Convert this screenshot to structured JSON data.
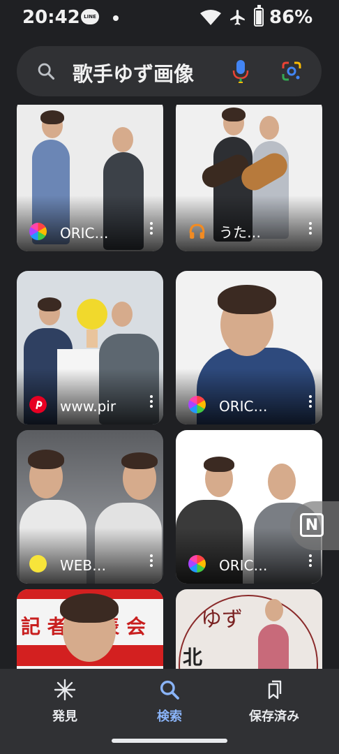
{
  "status_bar": {
    "time": "20:42",
    "line_badge": "LINE",
    "battery_percent": "86%",
    "battery_level": 0.86
  },
  "search": {
    "query": "歌手ゆず画像"
  },
  "results": [
    {
      "source_label": "ORIC…",
      "source_icon": "oricon-icon"
    },
    {
      "source_label": "うた…",
      "source_icon": "headphones-icon"
    },
    {
      "source_label": "www.pir",
      "source_icon": "pinterest-icon"
    },
    {
      "source_label": "ORIC…",
      "source_icon": "oricon-icon"
    },
    {
      "source_label": "WEB…",
      "source_icon": "yellow-dot-icon"
    },
    {
      "source_label": "ORIC…",
      "source_icon": "oricon-icon"
    },
    {
      "source_label": "",
      "source_icon": ""
    },
    {
      "source_label": "",
      "source_icon": ""
    }
  ],
  "image_text": {
    "banner_text": "記 者 発 表 会",
    "album_text": "ゆず",
    "album_sub": "北"
  },
  "floating_button": {
    "label": "N"
  },
  "bottom_nav": {
    "items": [
      {
        "label": "発見",
        "icon": "asterisk-icon"
      },
      {
        "label": "検索",
        "icon": "search-icon",
        "active": true
      },
      {
        "label": "保存済み",
        "icon": "bookmarks-icon"
      }
    ]
  },
  "colors": {
    "background": "#1f2023",
    "surface": "#303134",
    "active_accent": "#8ab4f8"
  }
}
